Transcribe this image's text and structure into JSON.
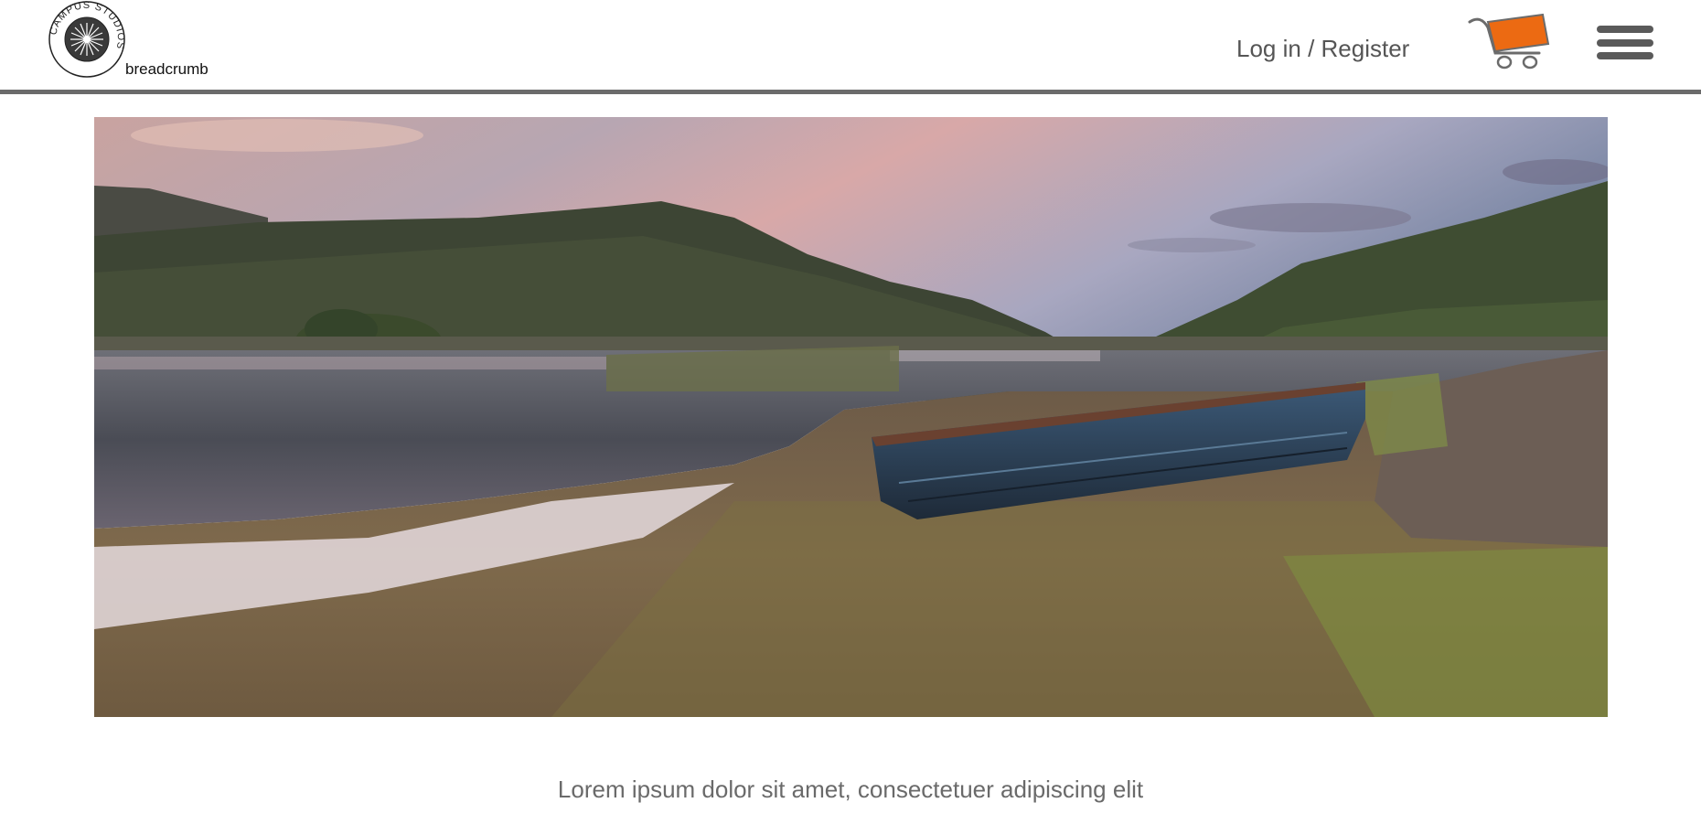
{
  "header": {
    "logo_text": "CAMPUS STUDIOS",
    "breadcrumb": "breadcrumb",
    "login_label": "Log in / Register",
    "cart_icon": "shopping-cart-icon",
    "menu_icon": "hamburger-menu-icon"
  },
  "colors": {
    "divider": "#6b6b6b",
    "cart_accent": "#ec6a12",
    "text_grey": "#555555"
  },
  "hero": {
    "image_desc": "lake-landscape-with-rowing-boat"
  },
  "content": {
    "caption": "Lorem ipsum dolor sit amet, consectetuer adipiscing elit"
  }
}
